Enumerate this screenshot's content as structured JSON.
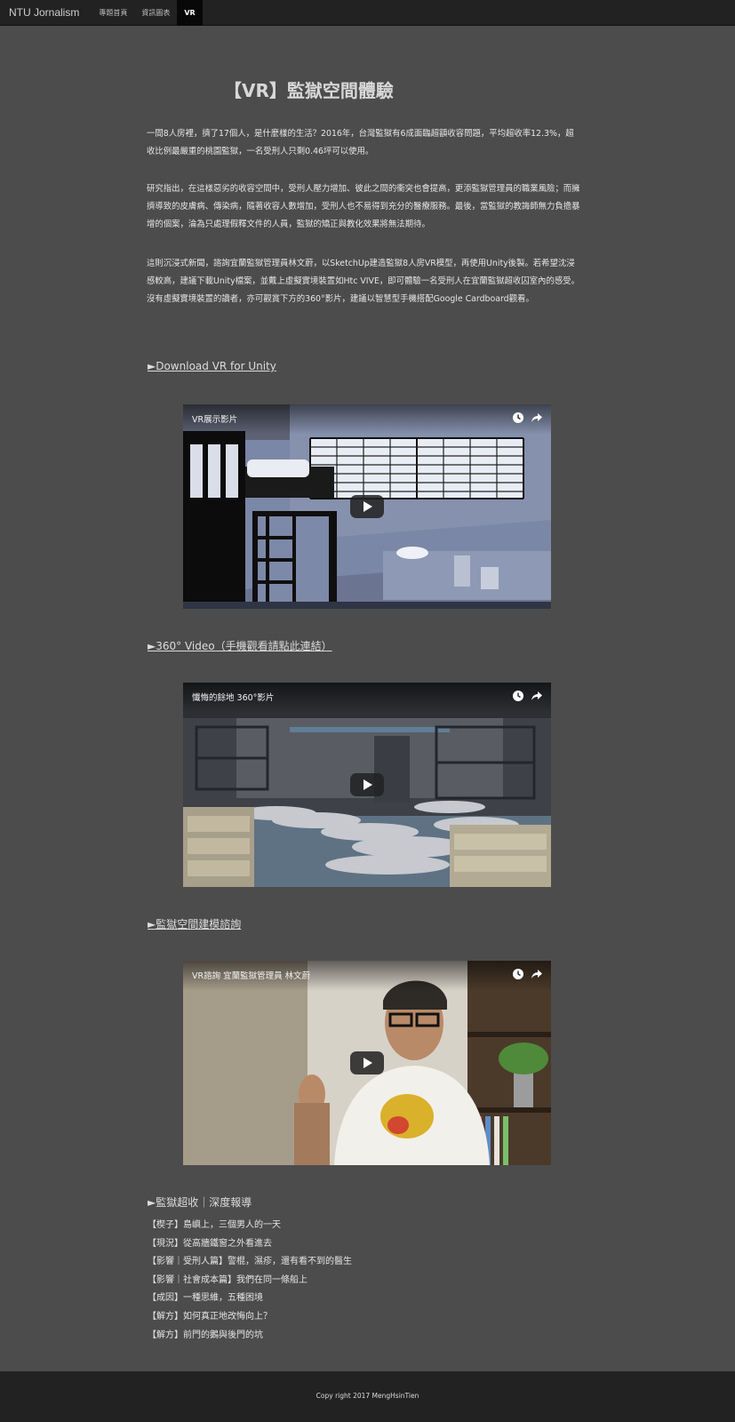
{
  "navbar": {
    "brand": "NTU Jornalism",
    "items": [
      "專題首頁",
      "資訊圖表",
      "VR"
    ],
    "active_index": 2
  },
  "page": {
    "title": "【VR】監獄空間體驗",
    "paragraphs": [
      "一間8人房裡，擠了17個人，是什麼樣的生活？2016年，台灣監獄有6成面臨超額收容問題，平均超收率12.3%，超收比例最嚴重的桃園監獄，一名受刑人只剩0.46坪可以使用。",
      "研究指出，在這樣惡劣的收容空間中，受刑人壓力增加、彼此之間的衝突也會提高，更添監獄管理員的職業風險；而擁擠導致的皮膚病、傳染病，隨著收容人數增加，受刑人也不易得到充分的醫療服務。最後，當監獄的教誨師無力負擔暴增的個案，淪為只處理假釋文件的人員，監獄的矯正與教化效果將無法期待。",
      "這則沉浸式新聞，諮詢宜蘭監獄管理員林文蔚，以SketchUp建造監獄8人房VR模型，再使用Unity後製。若希望沈浸感較高，建議下載Unity檔案，並戴上虛擬實境裝置如Htc VIVE，即可體驗一名受刑人在宜蘭監獄超收囚室內的感受。沒有虛擬實境裝置的讀者，亦可觀賞下方的360°影片，建議以智慧型手機搭配Google Cardboard觀看。"
    ]
  },
  "sections": {
    "download_link": "►Download VR for Unity",
    "video360_link": "►360° Video（手機觀看請點此連結）",
    "modeling_link": "►監獄空間建模諮詢",
    "report_heading": "►監獄超收｜深度報導"
  },
  "videos": [
    {
      "title": "VR展示影片",
      "icons": [
        "clock-icon",
        "share-icon",
        "play-icon"
      ]
    },
    {
      "title": "懺悔的餘地 360°影片",
      "icons": [
        "clock-icon",
        "share-icon",
        "play-icon"
      ]
    },
    {
      "title": "VR諮詢 宜蘭監獄管理員 林文蔚",
      "icons": [
        "clock-icon",
        "share-icon",
        "play-icon"
      ]
    }
  ],
  "reports": [
    "【楔子】島嶼上，三個男人的一天",
    "【現況】從高牆鐵窗之外看進去",
    "【影響｜受刑人篇】警棍，濕疹，還有看不到的醫生",
    "【影響｜社會成本篇】我們在同一條船上",
    "【成因】一種思維，五種困境",
    "【解方】如何真正地改悔向上？",
    "【解方】前門的鵝與後門的坑"
  ],
  "footer": {
    "copyright": "Copy right 2017 MengHsinTien"
  },
  "colors": {
    "background": "#4c4c4c",
    "navbar": "#222222",
    "footer": "#222222",
    "active_nav": "#080808"
  }
}
